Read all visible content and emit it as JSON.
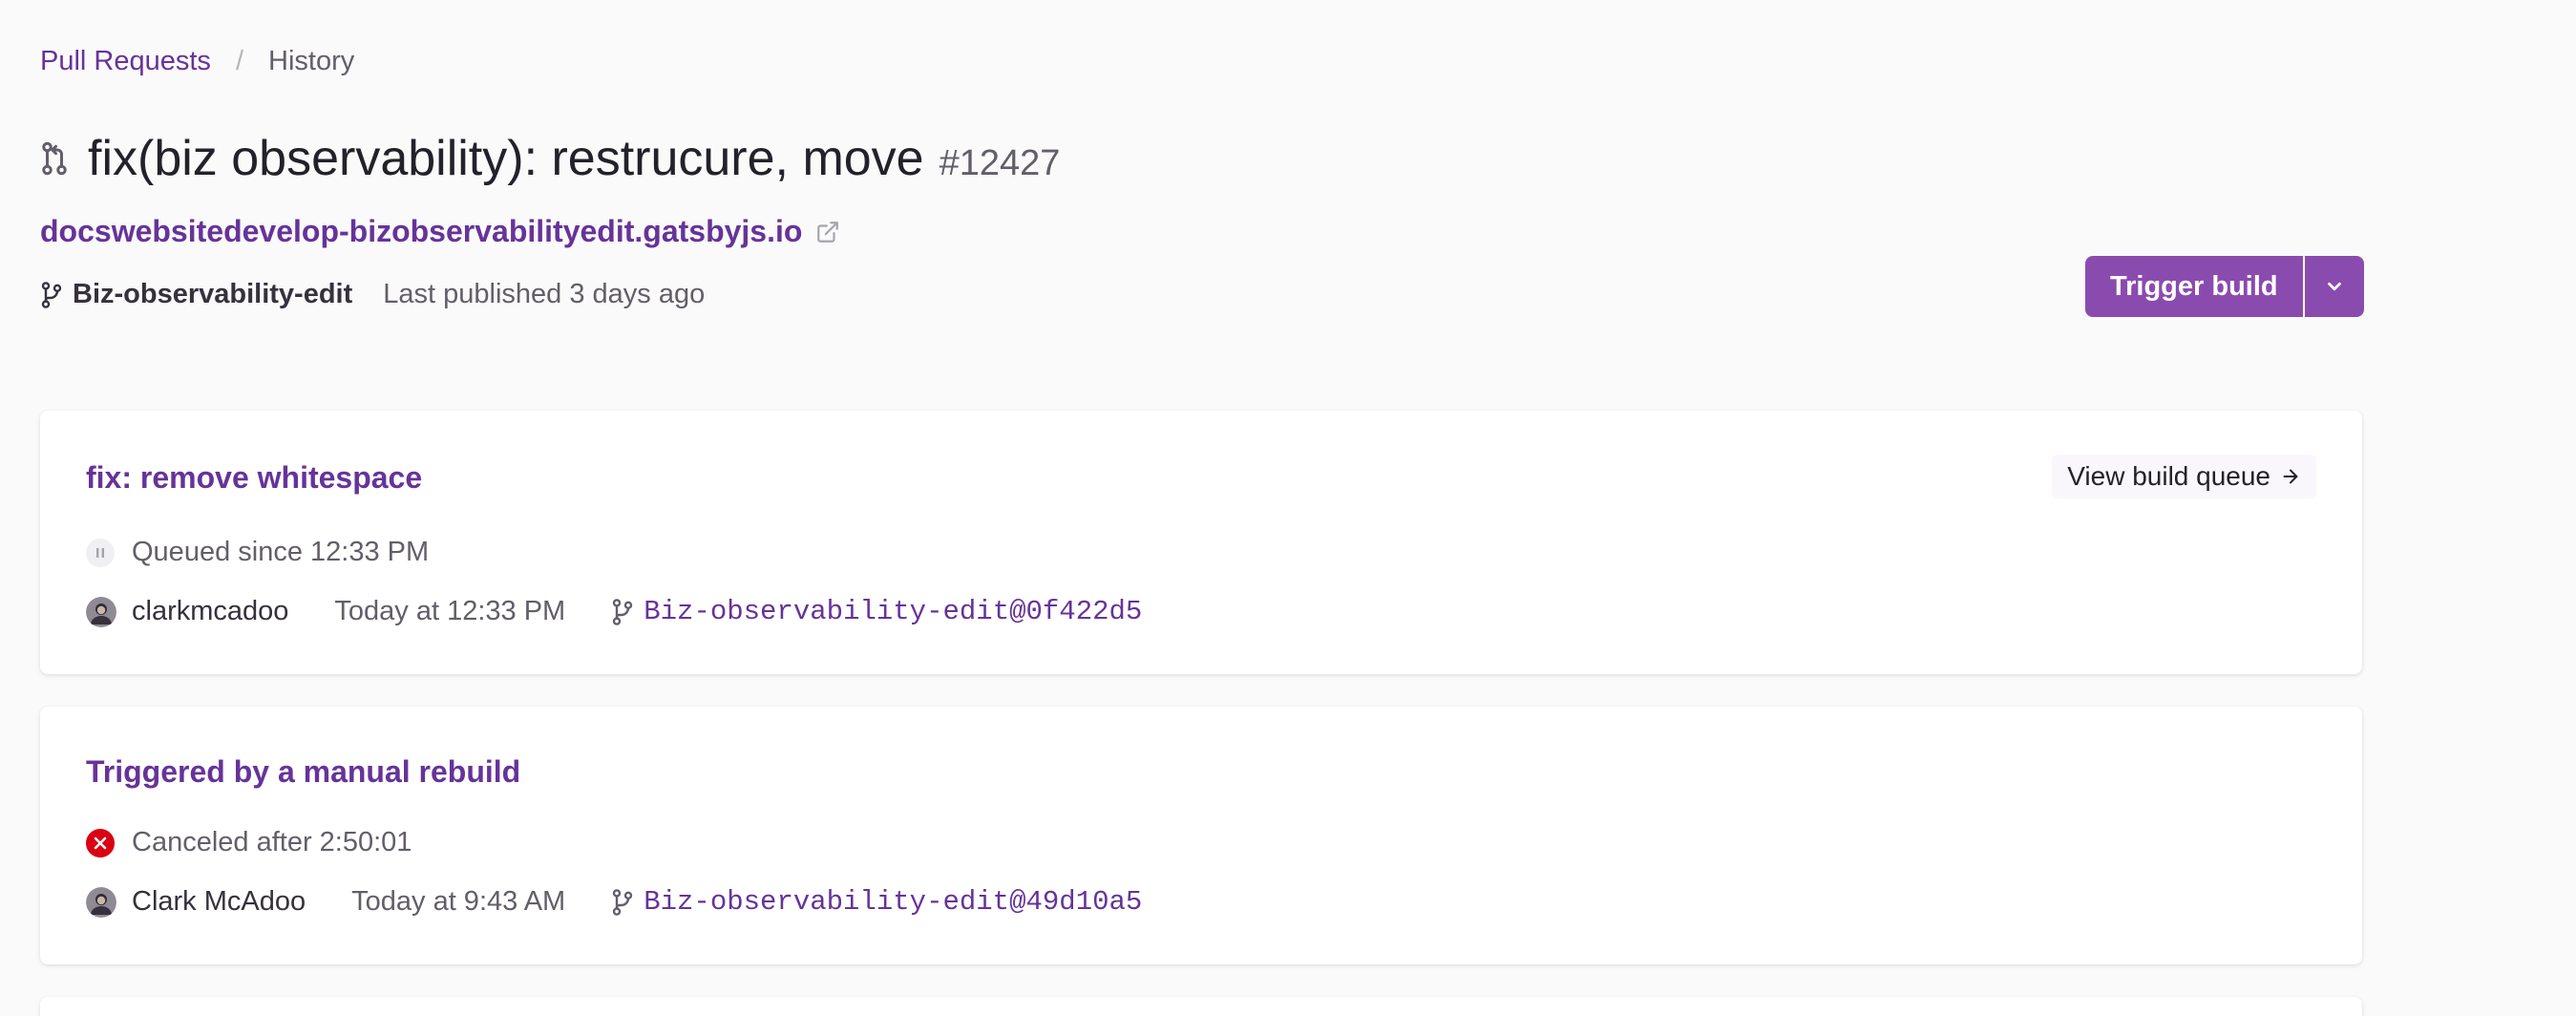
{
  "breadcrumb": {
    "link": "Pull Requests",
    "separator": "/",
    "current": "History"
  },
  "header": {
    "title": "fix(biz observability): restrucure, move",
    "number": "#12427",
    "preview_url": "docswebsitedevelop-bizobservabilityedit.gatsbyjs.io",
    "branch": "Biz-observability-edit",
    "last_published": "Last published 3 days ago"
  },
  "actions": {
    "trigger_build": "Trigger build"
  },
  "builds": [
    {
      "title": "fix: remove whitespace",
      "status": "Queued since 12:33 PM",
      "status_type": "queued",
      "author": "clarkmcadoo",
      "time": "Today at 12:33 PM",
      "commit": "Biz-observability-edit@0f422d5",
      "queue_link": "View build queue"
    },
    {
      "title": "Triggered by a manual rebuild",
      "status": "Canceled after 2:50:01",
      "status_type": "canceled",
      "author": "Clark McAdoo",
      "time": "Today at 9:43 AM",
      "commit": "Biz-observability-edit@49d10a5"
    }
  ],
  "colors": {
    "brand": "#663399",
    "button": "#8a4baf",
    "canceled": "#da0013"
  },
  "icons": {
    "title": "pull-request-icon",
    "external": "external-link-icon",
    "branch": "git-branch-icon",
    "queued": "pause-icon",
    "canceled": "x-circle-icon",
    "dropdown": "chevron-down-icon",
    "arrow": "arrow-right-icon"
  }
}
